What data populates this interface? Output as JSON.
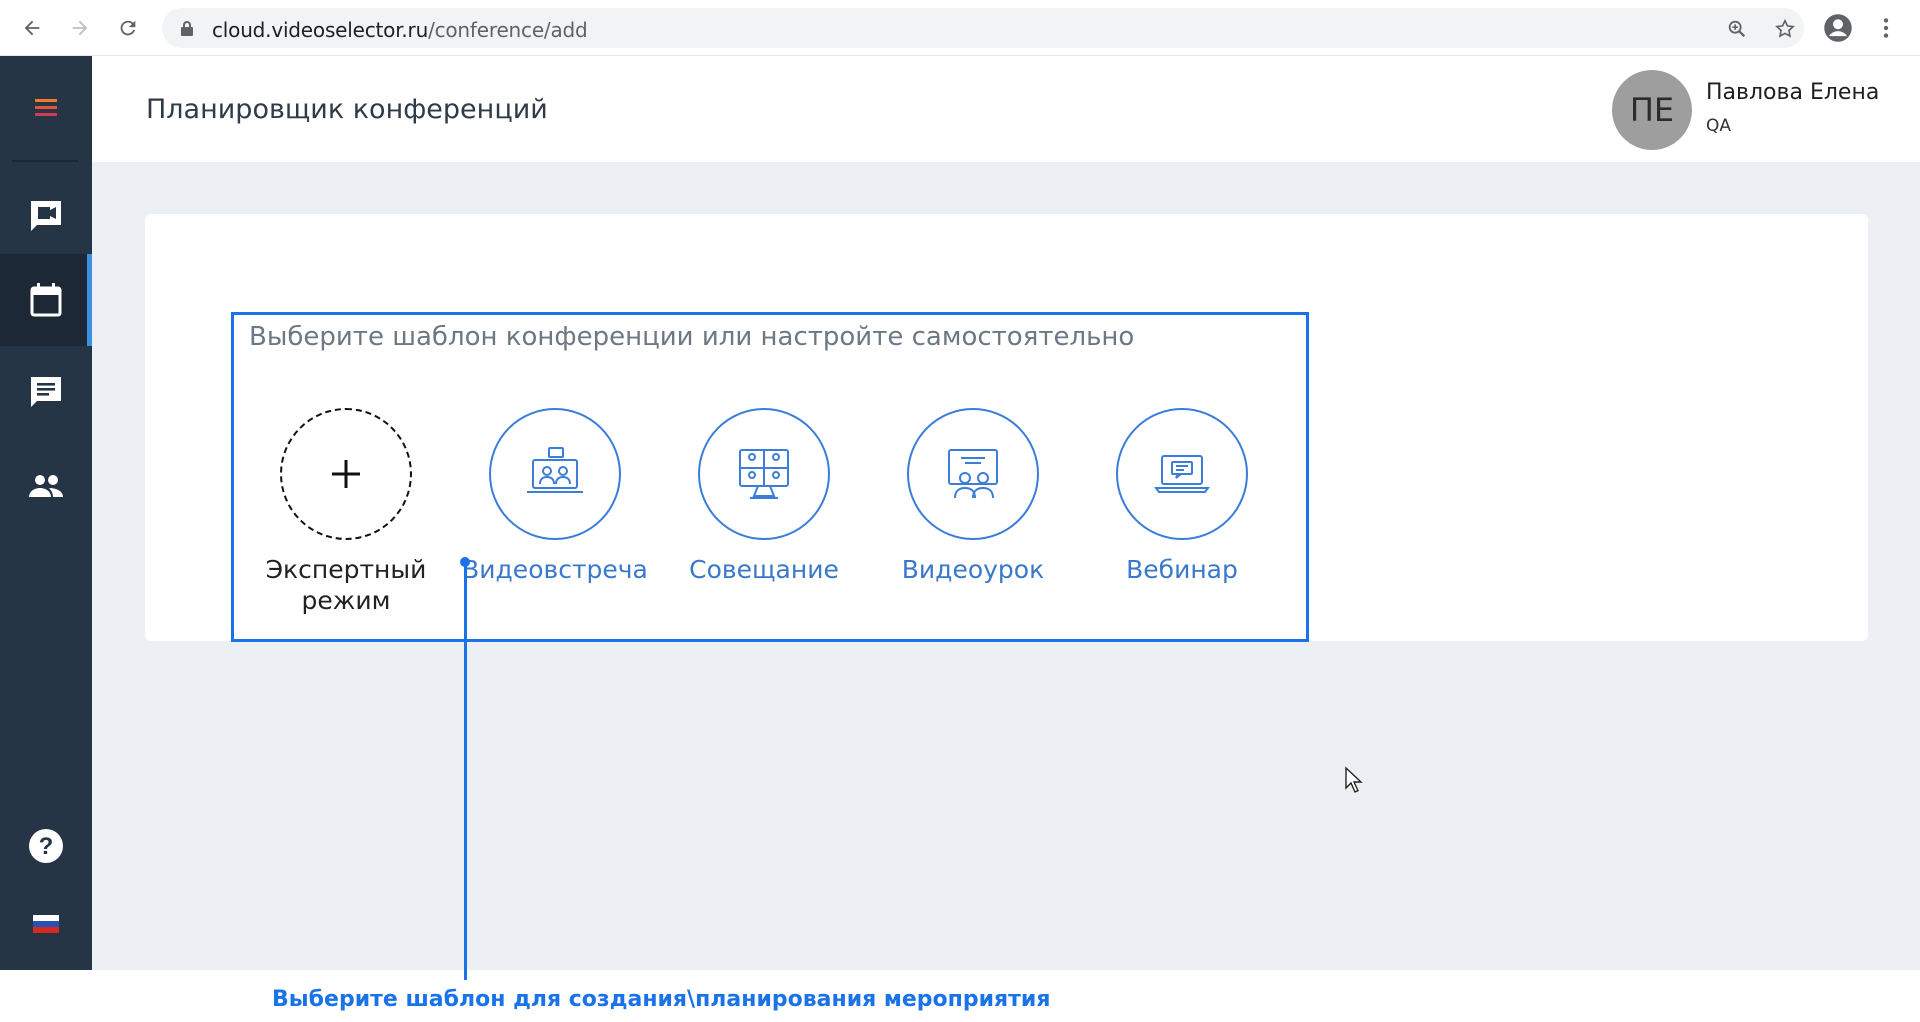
{
  "browser": {
    "url_host": "cloud.videoselector.ru",
    "url_path": "/conference/add"
  },
  "sidebar": {
    "items": [
      {
        "name": "menu",
        "icon": "hamburger-icon"
      },
      {
        "name": "conferences",
        "icon": "video-chat-icon"
      },
      {
        "name": "planner",
        "icon": "calendar-icon",
        "active": true
      },
      {
        "name": "chat",
        "icon": "message-icon"
      },
      {
        "name": "contacts",
        "icon": "people-icon"
      },
      {
        "name": "help",
        "icon": "help-icon"
      },
      {
        "name": "language",
        "icon": "russia-flag-icon"
      }
    ]
  },
  "header": {
    "title": "Планировщик конференций",
    "user": {
      "initials": "ПЕ",
      "name": "Павлова Елена",
      "role": "QA"
    }
  },
  "chooser": {
    "title": "Выберите шаблон конференции или настройте самостоятельно",
    "templates": [
      {
        "label": "Экспертный режим",
        "icon": "plus-icon"
      },
      {
        "label": "Видеовстреча",
        "icon": "video-meeting-icon"
      },
      {
        "label": "Совещание",
        "icon": "conference-grid-icon"
      },
      {
        "label": "Видеоурок",
        "icon": "video-lesson-icon"
      },
      {
        "label": "Вебинар",
        "icon": "webinar-icon"
      }
    ]
  },
  "annotation": {
    "text": "Выберите шаблон для создания\\планирования мероприятия"
  },
  "colors": {
    "sidebar": "#263545",
    "accent": "#1a73e8",
    "template_label": "#3a78c9",
    "background": "#eceff3"
  }
}
